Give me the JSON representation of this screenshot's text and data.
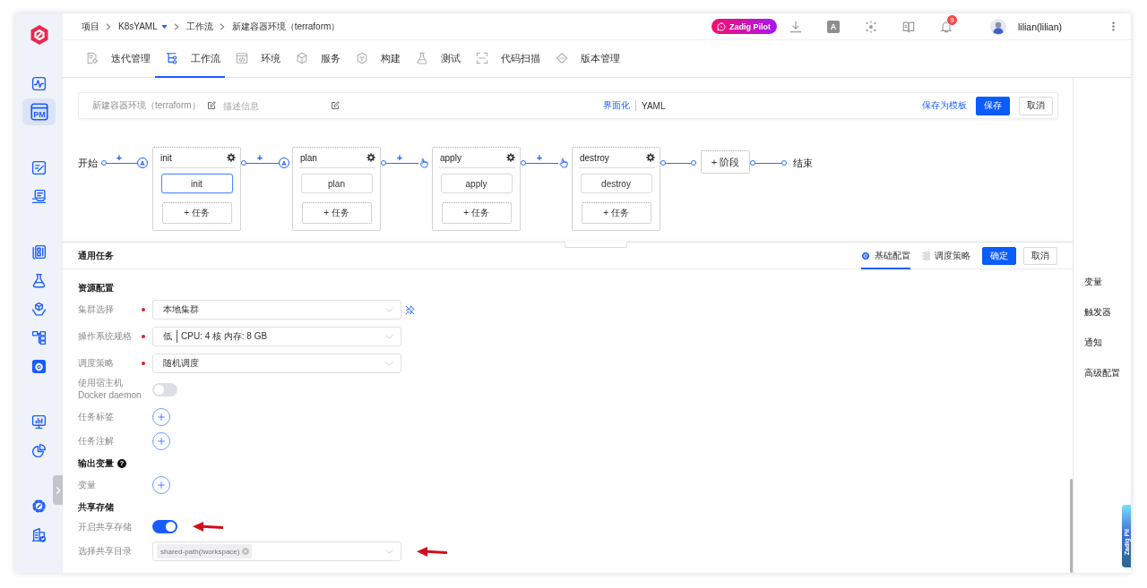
{
  "sidebar": {
    "groups": [
      [
        {
          "selected": false
        },
        {
          "selected": true,
          "icon_text": "PM"
        }
      ],
      [
        {
          "selected": false
        },
        {
          "selected": false
        }
      ],
      [
        {
          "selected": false
        },
        {
          "selected": false
        },
        {
          "selected": false
        },
        {
          "selected": false
        },
        {
          "selected": false
        }
      ],
      [
        {
          "selected": false
        },
        {
          "selected": false
        }
      ],
      [
        {
          "selected": false
        },
        {
          "selected": false
        }
      ]
    ]
  },
  "topbar": {
    "breadcrumb": [
      {
        "label": "项目",
        "dropdown": false
      },
      {
        "label": "K8sYAML",
        "dropdown": true
      },
      {
        "label": "工作流",
        "dropdown": false
      },
      {
        "label": "新建容器环境（terraform）",
        "dropdown": false
      }
    ],
    "pilot": {
      "label": "Zadig Pilot"
    },
    "translate": {
      "label": "A"
    },
    "notifications": {
      "count": "9"
    },
    "user": {
      "name": "lilian(lilian)"
    }
  },
  "nav": {
    "tabs": [
      {
        "label": "迭代管理",
        "selected": false
      },
      {
        "label": "工作流",
        "selected": true
      },
      {
        "label": "环境",
        "selected": false
      },
      {
        "label": "服务",
        "selected": false
      },
      {
        "label": "构建",
        "selected": false
      },
      {
        "label": "测试",
        "selected": false
      },
      {
        "label": "代码扫描",
        "selected": false
      },
      {
        "label": "版本管理",
        "selected": false
      }
    ]
  },
  "toolbar": {
    "name": "新建容器环境（terraform）",
    "description": {
      "placeholder": "描述信息"
    },
    "modes": [
      {
        "label": "界面化",
        "selected": true
      },
      {
        "label": "YAML",
        "selected": false
      }
    ],
    "save_template": "保存为模板",
    "buttons": [
      {
        "label": "保存",
        "kind": "primary"
      },
      {
        "label": "取消",
        "kind": "default"
      }
    ]
  },
  "pipeline": {
    "start": "开始",
    "stages": [
      {
        "name": "init",
        "connector": {
          "label": "+",
          "trigger": {
            "kind": "auto",
            "label": "A"
          }
        },
        "jobs": [
          {
            "label": "init",
            "selected": true
          }
        ],
        "add_job": "+ 任务"
      },
      {
        "name": "plan",
        "connector": {
          "label": "+",
          "trigger": {
            "kind": "auto",
            "label": "A"
          }
        },
        "jobs": [
          {
            "label": "plan",
            "selected": false
          }
        ],
        "add_job": "+ 任务"
      },
      {
        "name": "apply",
        "connector": {
          "label": "+",
          "trigger": {
            "kind": "manual"
          }
        },
        "jobs": [
          {
            "label": "apply",
            "selected": false
          }
        ],
        "add_job": "+ 任务"
      },
      {
        "name": "destroy",
        "connector": {
          "label": "+",
          "trigger": {
            "kind": "manual"
          }
        },
        "jobs": [
          {
            "label": "destroy",
            "selected": false
          }
        ],
        "add_job": "+ 任务"
      }
    ],
    "add_stage": "+ 阶段",
    "end": "结束"
  },
  "panel": {
    "title": "通用任务",
    "tabs": [
      {
        "label": "基础配置",
        "selected": true
      },
      {
        "label": "调度策略",
        "selected": false
      }
    ],
    "buttons": [
      {
        "label": "确定",
        "kind": "primary"
      },
      {
        "label": "取消",
        "kind": "default"
      }
    ],
    "form": [
      {
        "kind": "section",
        "label": "资源配置"
      },
      {
        "kind": "select",
        "label": "集群选择",
        "required": true,
        "value": "本地集群",
        "pin": true
      },
      {
        "kind": "select",
        "label": "操作系统规格",
        "required": true,
        "value": "低",
        "detail": "CPU: 4 核 内存: 8 GB"
      },
      {
        "kind": "select",
        "label": "调度策略",
        "required": true,
        "value": "随机调度"
      },
      {
        "kind": "toggle",
        "label_lines": [
          "使用宿主机",
          "Docker daemon"
        ],
        "on": false
      },
      {
        "kind": "add",
        "label": "任务标签"
      },
      {
        "kind": "add",
        "label": "任务注解"
      },
      {
        "kind": "section",
        "label": "输出变量",
        "help": "?"
      },
      {
        "kind": "add",
        "label": "变量"
      },
      {
        "kind": "section",
        "label": "共享存储"
      },
      {
        "kind": "toggle",
        "label": "开启共享存储",
        "on": true,
        "annotated": true
      },
      {
        "kind": "select",
        "label": "选择共享目录",
        "required": false,
        "tags": [
          "shared-path(/workspace)"
        ],
        "annotated": true
      }
    ]
  },
  "side_menu": {
    "items": [
      {
        "label": "变量"
      },
      {
        "label": "触发器"
      },
      {
        "label": "通知"
      },
      {
        "label": "高级配置"
      }
    ]
  },
  "assistant_tab": {
    "label": "Zadig Pil"
  }
}
